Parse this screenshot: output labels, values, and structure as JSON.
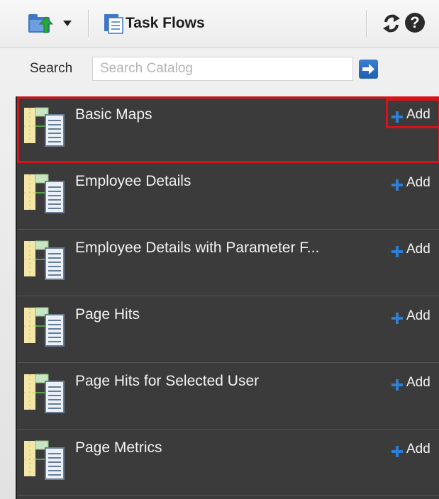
{
  "toolbar": {
    "task_flows_label": "Task Flows",
    "help_symbol": "?"
  },
  "search": {
    "label": "Search",
    "placeholder": "Search Catalog",
    "value": ""
  },
  "catalog": {
    "add_label": "Add",
    "items": [
      {
        "title": "Basic Maps",
        "selected": true
      },
      {
        "title": "Employee Details",
        "selected": false
      },
      {
        "title": "Employee Details with Parameter F...",
        "selected": false
      },
      {
        "title": "Page Hits",
        "selected": false
      },
      {
        "title": "Page Hits for Selected User",
        "selected": false
      },
      {
        "title": "Page Metrics",
        "selected": false
      }
    ]
  },
  "colors": {
    "list_background": "#3b3b3b",
    "highlight": "#d8121a",
    "accent_blue": "#2d7fd6"
  },
  "icons": {
    "up_folder": "folder-up-icon",
    "dropdown": "chevron-down-icon",
    "task_flows": "task-flows-icon",
    "refresh": "refresh-icon",
    "help": "help-icon",
    "search_go": "arrow-right-icon",
    "item": "task-flow-item-icon",
    "add": "plus-icon"
  }
}
